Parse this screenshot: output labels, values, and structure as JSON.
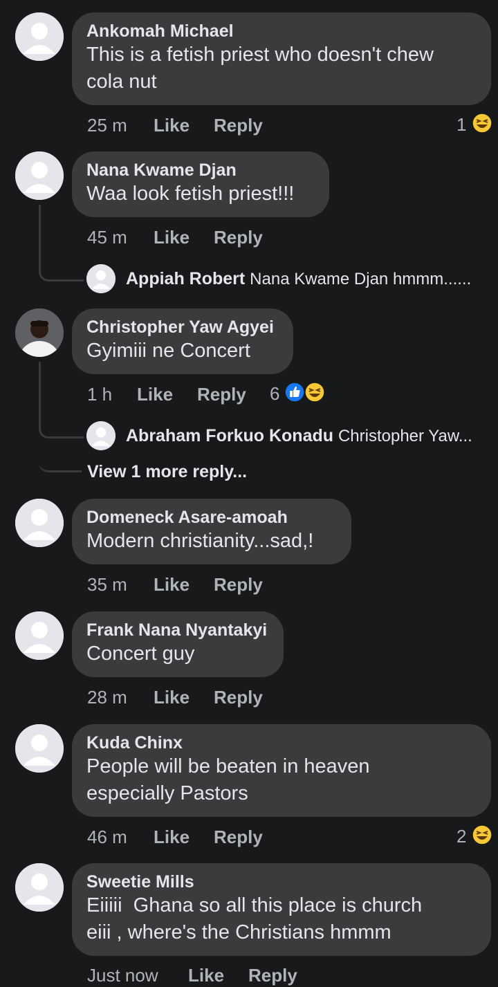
{
  "comments": [
    {
      "name": "Ankomah Michael",
      "text": [
        "This is a fetish priest who doesn't chew",
        "cola nut"
      ],
      "time": "25 m",
      "like": "Like",
      "reply": "Reply",
      "reactions": "1",
      "reaction_icons": [
        "haha-emoji-icon"
      ]
    },
    {
      "name": "Nana Kwame Djan",
      "text": [
        "Waa look fetish priest!!!"
      ],
      "time": "45 m",
      "like": "Like",
      "reply": "Reply",
      "replies": [
        {
          "name": "Appiah Robert",
          "text": "Nana Kwame Djan hmmm......"
        }
      ]
    },
    {
      "name": "Christopher Yaw Agyei",
      "text": [
        "Gyimiii ne Concert"
      ],
      "time": "1 h",
      "like": "Like",
      "reply": "Reply",
      "reactions": "6",
      "reaction_icons": [
        "like-reaction-icon",
        "haha-emoji-icon"
      ],
      "replies": [
        {
          "name": "Abraham Forkuo Konadu",
          "text": "Christopher Yaw..."
        }
      ],
      "more_replies": "View 1 more reply..."
    },
    {
      "name": "Domeneck Asare-amoah",
      "text": [
        "Modern christianity...sad,!"
      ],
      "time": "35 m",
      "like": "Like",
      "reply": "Reply"
    },
    {
      "name": "Frank Nana Nyantakyi",
      "text": [
        "Concert guy"
      ],
      "time": "28 m",
      "like": "Like",
      "reply": "Reply"
    },
    {
      "name": "Kuda Chinx",
      "text": [
        "People will be beaten in heaven",
        "especially Pastors"
      ],
      "time": "46 m",
      "like": "Like",
      "reply": "Reply",
      "reactions": "2",
      "reaction_icons": [
        "haha-emoji-icon"
      ]
    },
    {
      "name": "Sweetie Mills",
      "text": [
        "Eiiiii  Ghana so all this place is church",
        "eiii , where's the Christians hmmm"
      ],
      "time": "Just now",
      "like": "Like",
      "reply": "Reply"
    }
  ],
  "colors": {
    "background": "#18191a",
    "bubble": "#3a3b3c",
    "text": "#e4e6eb",
    "muted": "#b0b3b8",
    "like_blue": "#1877f2",
    "haha_yellow": "#f7c836"
  }
}
